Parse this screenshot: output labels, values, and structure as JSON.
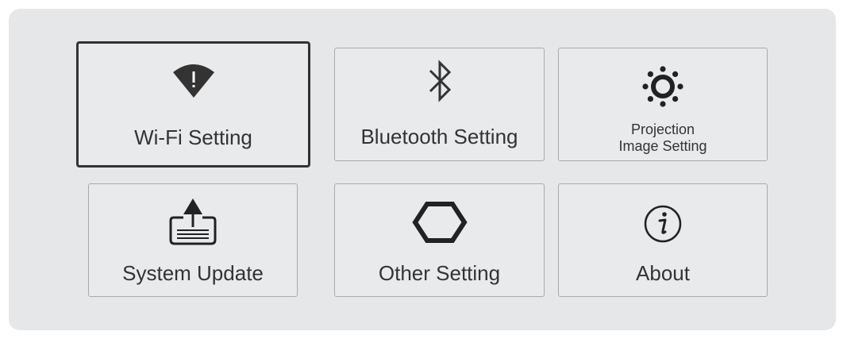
{
  "settings_menu": {
    "tiles": [
      {
        "label": "Wi-Fi Setting",
        "icon": "wifi-warning-icon",
        "selected": true
      },
      {
        "label": "Bluetooth Setting",
        "icon": "bluetooth-icon",
        "selected": false
      },
      {
        "label_line1": "Projection",
        "label_line2": "Image Setting",
        "icon": "brightness-icon",
        "selected": false
      },
      {
        "label": "System Update",
        "icon": "upload-icon",
        "selected": false
      },
      {
        "label": "Other Setting",
        "icon": "hexagon-icon",
        "selected": false
      },
      {
        "label": "About",
        "icon": "info-icon",
        "selected": false
      }
    ]
  },
  "colors": {
    "panel_background": "#e6e7e8",
    "tile_border": "#a9aaab",
    "selected_border": "#333333",
    "text": "#333333"
  }
}
